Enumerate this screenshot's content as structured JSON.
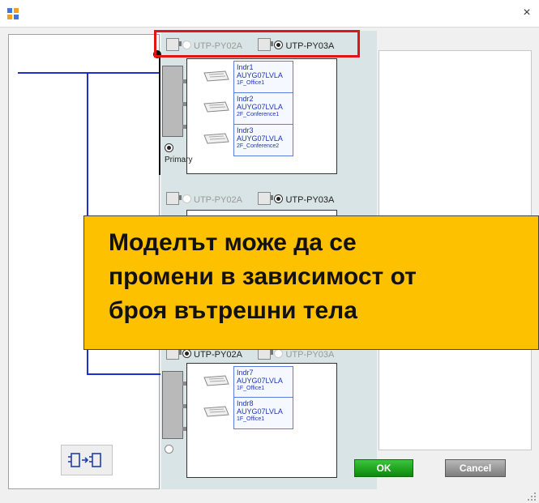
{
  "window": {
    "close_glyph": "×",
    "app_icon": "app-window-icon"
  },
  "groups": [
    {
      "option_a": "UTP-PY02A",
      "option_b": "UTP-PY03A",
      "selected": "b",
      "primary_label": "Primary",
      "primary_selected": true,
      "indoor": [
        {
          "name": "Indr1",
          "model": "AUYG07LVLA",
          "zone": "1F_Office1"
        },
        {
          "name": "Indr2",
          "model": "AUYG07LVLA",
          "zone": "2F_Conference1"
        },
        {
          "name": "Indr3",
          "model": "AUYG07LVLA",
          "zone": "2F_Conference2"
        }
      ]
    },
    {
      "option_a": "UTP-PY02A",
      "option_b": "UTP-PY03A",
      "selected": "b"
    },
    {
      "option_a": "UTP-PY02A",
      "option_b": "UTP-PY03A",
      "selected": "a",
      "primary_selected": false,
      "indoor": [
        {
          "name": "Indr7",
          "model": "AUYG07LVLA",
          "zone": "1F_Office1"
        },
        {
          "name": "Indr8",
          "model": "AUYG07LVLA",
          "zone": "1F_Office1"
        }
      ]
    }
  ],
  "callout": {
    "line1": "Моделът може да се",
    "line2": "промени в зависимост от",
    "line3": "броя вътрешни тела"
  },
  "buttons": {
    "ok": "OK",
    "cancel": "Cancel",
    "swap_icon": "swap-units-icon"
  },
  "colors": {
    "highlight": "#e01515",
    "callout_bg": "#fec100",
    "line": "#1f2fd0",
    "ok_green": "#0a8a0a"
  }
}
